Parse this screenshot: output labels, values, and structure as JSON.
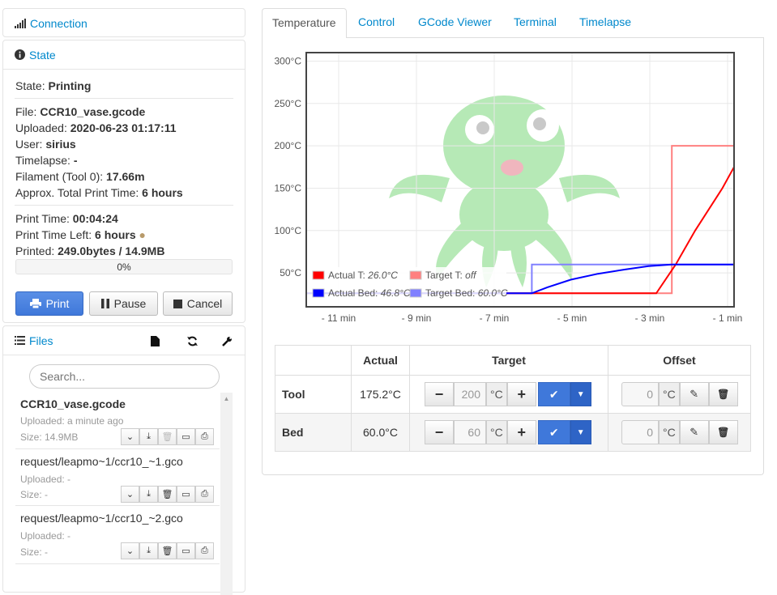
{
  "connection": {
    "title": "Connection"
  },
  "state": {
    "title": "State",
    "state_label": "State:",
    "state_value": "Printing",
    "file_label": "File:",
    "file_value": "CCR10_vase.gcode",
    "uploaded_label": "Uploaded:",
    "uploaded_value": "2020-06-23 01:17:11",
    "user_label": "User:",
    "user_value": "sirius",
    "timelapse_label": "Timelapse:",
    "timelapse_value": "-",
    "filament_label": "Filament (Tool 0):",
    "filament_value": "17.66m",
    "approx_label": "Approx. Total Print Time:",
    "approx_value": "6 hours",
    "printtime_label": "Print Time:",
    "printtime_value": "00:04:24",
    "timeleft_label": "Print Time Left:",
    "timeleft_value": "6 hours",
    "printed_label": "Printed:",
    "printed_value": "249.0bytes / 14.9MB",
    "progress_text": "0%",
    "progress_fraction": 0.0,
    "buttons": {
      "print": "Print",
      "pause": "Pause",
      "cancel": "Cancel"
    }
  },
  "files": {
    "title": "Files",
    "search_placeholder": "Search...",
    "items": [
      {
        "name": "CCR10_vase.gcode",
        "uploaded": "Uploaded: a minute ago",
        "size": "Size: 14.9MB"
      },
      {
        "name": "request/leapmo~1/ccr10_~1.gco",
        "uploaded": "Uploaded: -",
        "size": "Size: -"
      },
      {
        "name": "request/leapmo~1/ccr10_~2.gco",
        "uploaded": "Uploaded: -",
        "size": "Size: -"
      }
    ]
  },
  "tabs": [
    "Temperature",
    "Control",
    "GCode Viewer",
    "Terminal",
    "Timelapse"
  ],
  "chart_data": {
    "type": "line",
    "y_ticks": [
      "300°C",
      "250°C",
      "200°C",
      "150°C",
      "100°C",
      "50°C"
    ],
    "x_ticks": [
      "- 11 min",
      "- 9 min",
      "- 7 min",
      "- 5 min",
      "- 3 min",
      "- 1 min"
    ],
    "ylim": [
      10,
      310
    ],
    "xlim": [
      -11.0,
      0
    ],
    "series": [
      {
        "name": "Actual T:",
        "value_text": "26.0°C",
        "color": "#ff0000",
        "x": [
          -11,
          -5.2,
          -4.5,
          -4.0,
          -3.5,
          -3.0,
          -2.5,
          -2.0,
          -1.5,
          -1.0,
          -0.3,
          0
        ],
        "y": [
          26,
          26,
          26,
          26,
          26,
          26,
          26,
          26,
          60,
          100,
          150,
          175
        ]
      },
      {
        "name": "Target T:",
        "value_text": "off",
        "color": "#ff8080",
        "x": [
          -11,
          -1.6,
          -1.6,
          0
        ],
        "y": [
          26,
          26,
          200,
          200
        ]
      },
      {
        "name": "Actual Bed:",
        "value_text": "46.8°C",
        "color": "#0000ff",
        "x": [
          -11,
          -5.2,
          -4.8,
          -4.2,
          -3.5,
          -2.8,
          -2.2,
          -1.6,
          0
        ],
        "y": [
          26,
          26,
          33,
          42,
          49,
          54,
          58,
          60,
          60
        ]
      },
      {
        "name": "Target Bed:",
        "value_text": "60.0°C",
        "color": "#8080ff",
        "x": [
          -11,
          -5.2,
          -5.2,
          0
        ],
        "y": [
          26,
          26,
          60,
          60
        ]
      }
    ]
  },
  "temp_table": {
    "headers": [
      "",
      "Actual",
      "Target",
      "Offset"
    ],
    "rows": [
      {
        "name": "Tool",
        "actual": "175.2°C",
        "target": "200",
        "offset": "0"
      },
      {
        "name": "Bed",
        "actual": "60.0°C",
        "target": "60",
        "offset": "0"
      }
    ],
    "unit": "°C"
  }
}
